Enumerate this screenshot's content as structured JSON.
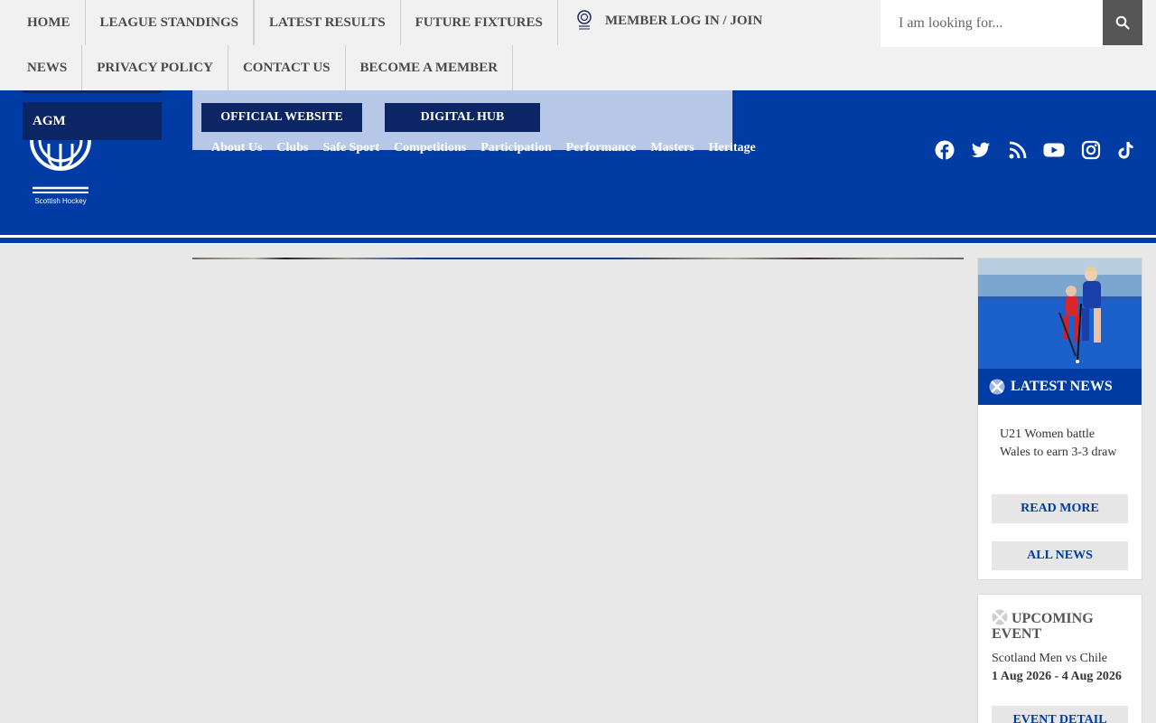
{
  "topnav": {
    "row1": [
      "HOME",
      "LEAGUE STANDINGS",
      "LATEST RESULTS",
      "FUTURE FIXTURES"
    ],
    "row2": [
      "NEWS",
      "PRIVACY POLICY",
      "CONTACT US",
      "BECOME A MEMBER"
    ],
    "member_label": "MEMBER LOG IN / JOIN"
  },
  "search": {
    "placeholder": "I am looking for...",
    "icon": "search-icon"
  },
  "header": {
    "agm_label": "AGM",
    "logo_text": "Scottish Hockey",
    "buttons": [
      "OFFICIAL WEBSITE",
      "DIGITAL HUB"
    ],
    "subnav": [
      "About Us",
      "Clubs",
      "Safe Sport",
      "Competitions",
      "Participation",
      "Performance",
      "Masters",
      "Heritage"
    ],
    "social_icons": [
      "facebook-icon",
      "twitter-icon",
      "rss-icon",
      "youtube-icon",
      "instagram-icon",
      "tiktok-icon"
    ]
  },
  "news": {
    "heading": "LATEST NEWS",
    "headline": "U21 Women battle Wales to earn 3-3 draw",
    "read_more": "READ MORE",
    "all_news": "ALL NEWS"
  },
  "event": {
    "heading": "UPCOMING EVENT",
    "title": "Scotland Men vs Chile",
    "date": "1 Aug 2026 - 4 Aug 2026",
    "detail": "EVENT DETAIL"
  },
  "colors": {
    "brand_blue": "#003ca3",
    "dark_navy": "#0b2565",
    "light_blue_panel": "#b6c7e8"
  }
}
